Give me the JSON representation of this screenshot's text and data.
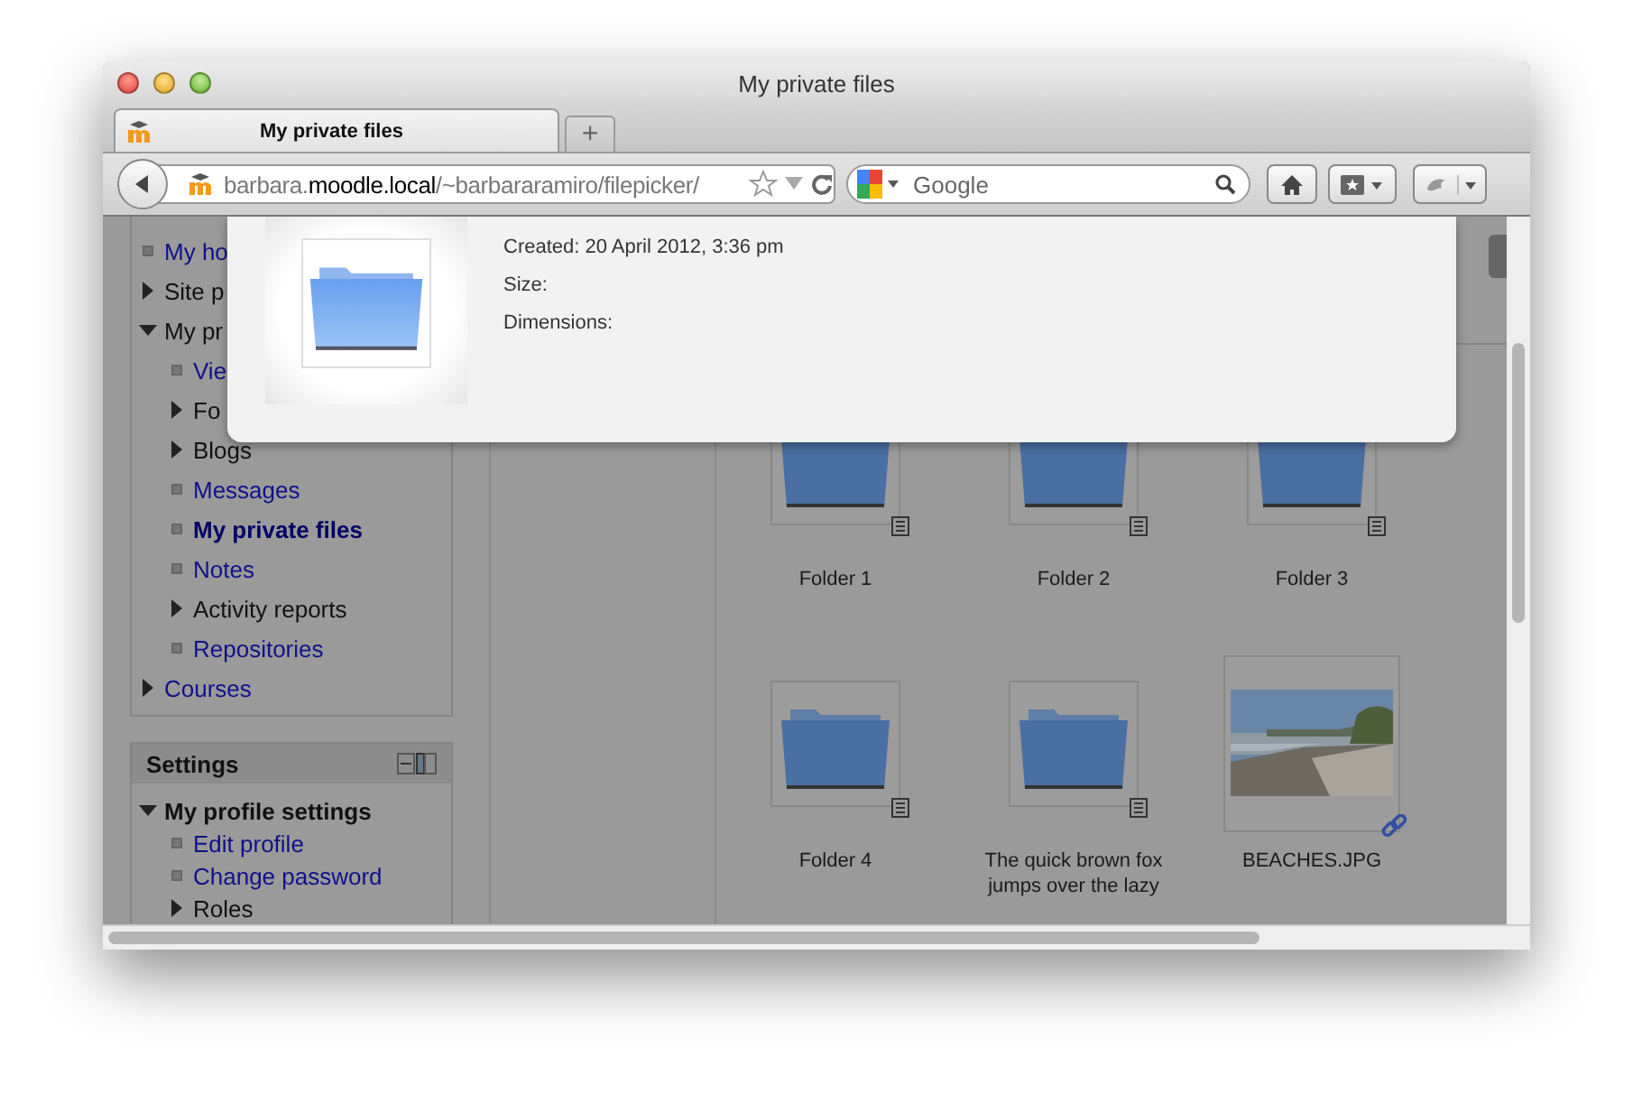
{
  "window": {
    "title": "My private files"
  },
  "tabs": [
    {
      "label": "My private files",
      "selected": true
    }
  ],
  "new_tab_button": {
    "label": "+"
  },
  "address_bar": {
    "subdomain": "barbara.",
    "domain": "moodle.local",
    "path": "/~barbararamiro/filepicker/"
  },
  "search": {
    "placeholder": "Google"
  },
  "navigation": {
    "items": [
      {
        "label": "My ho",
        "kind": "leaf",
        "link": true,
        "selected": false
      },
      {
        "label": "Site p",
        "kind": "branch",
        "link": false,
        "expanded": false,
        "selected": false
      },
      {
        "label": "My pr",
        "kind": "branch",
        "link": false,
        "expanded": true,
        "selected": false,
        "children": [
          {
            "label": "Vie",
            "kind": "leaf",
            "link": true,
            "selected": false
          },
          {
            "label": "Fo",
            "kind": "branch",
            "link": false,
            "expanded": false,
            "selected": false
          },
          {
            "label": "Blogs",
            "kind": "branch",
            "link": false,
            "expanded": false,
            "selected": false
          },
          {
            "label": "Messages",
            "kind": "leaf",
            "link": true,
            "selected": false
          },
          {
            "label": "My private files",
            "kind": "leaf",
            "link": true,
            "selected": true
          },
          {
            "label": "Notes",
            "kind": "leaf",
            "link": true,
            "selected": false
          },
          {
            "label": "Activity reports",
            "kind": "branch",
            "link": false,
            "expanded": false,
            "selected": false
          },
          {
            "label": "Repositories",
            "kind": "leaf",
            "link": true,
            "selected": false
          }
        ]
      },
      {
        "label": "Courses",
        "kind": "branch",
        "link": true,
        "expanded": false,
        "selected": false
      }
    ]
  },
  "settings": {
    "title": "Settings",
    "items": [
      {
        "label": "My profile settings",
        "kind": "branch",
        "link": false,
        "expanded": true,
        "selected": false,
        "children": [
          {
            "label": "Edit profile",
            "kind": "leaf",
            "link": true,
            "selected": false
          },
          {
            "label": "Change password",
            "kind": "leaf",
            "link": true,
            "selected": false
          },
          {
            "label": "Roles",
            "kind": "branch",
            "link": false,
            "expanded": false,
            "selected": false
          }
        ]
      }
    ]
  },
  "files": [
    {
      "name": "Folder 1",
      "kind": "folder"
    },
    {
      "name": "Folder 2",
      "kind": "folder"
    },
    {
      "name": "Folder 3",
      "kind": "folder"
    },
    {
      "name": "Folder 4",
      "kind": "folder"
    },
    {
      "name": "The quick brown fox jumps over the lazy",
      "kind": "folder"
    },
    {
      "name": "BEACHES.JPG"
    }
  ],
  "file_details": {
    "lines": [
      "Created: 20 April 2012, 3:36 pm",
      "Size:",
      "Dimensions:"
    ]
  }
}
